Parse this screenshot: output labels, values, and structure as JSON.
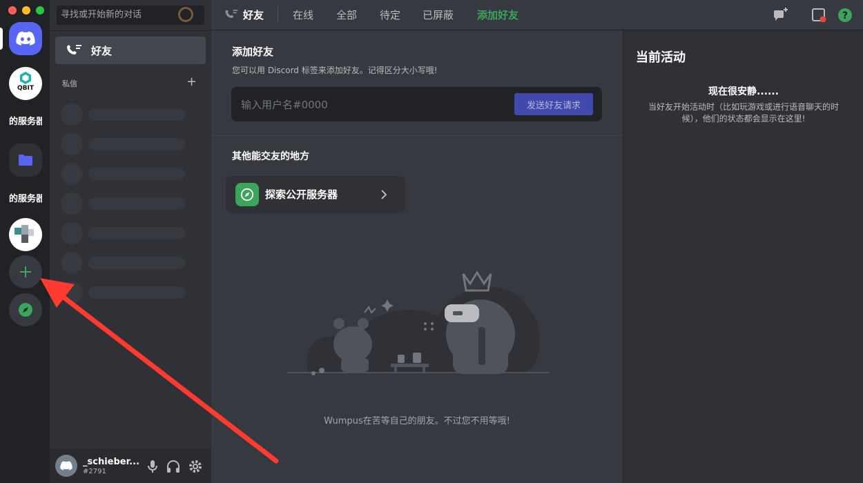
{
  "search": {
    "placeholder": "寻找或开始新的对话"
  },
  "rail": {
    "qbit_label": "QBIT",
    "server_text_1": "的服务器",
    "server_text_2": "的服务器"
  },
  "sidebar": {
    "friends_label": "好友",
    "dm_header": "私信",
    "dm_add": "+"
  },
  "user": {
    "name": "_schieber...",
    "tag": "#2791"
  },
  "topbar": {
    "title": "好友",
    "tabs": [
      "在线",
      "全部",
      "待定",
      "已屏蔽"
    ],
    "add_friend_tab": "添加好友"
  },
  "add_friend": {
    "title": "添加好友",
    "description": "您可以用 Discord 标签来添加好友。记得区分大小写哦!",
    "input_placeholder": "输入用户名#0000",
    "send_button": "发送好友请求"
  },
  "other_places": {
    "title": "其他能交友的地方",
    "explore_label": "探索公开服务器"
  },
  "empty_state": {
    "caption": "Wumpus在苦等自己的朋友。不过您不用等哦!"
  },
  "activity": {
    "title": "当前活动",
    "quiet": "现在很安静......",
    "description": "当好友开始活动时（比如玩游戏或进行语音聊天的时候），他们的状态都会显示在这里!"
  },
  "colors": {
    "accent": "#5865f2",
    "green": "#3ba55c",
    "annotation_arrow": "#ff3b30",
    "help_icon": "#3ba55c",
    "inbox_dot": "#ed4245"
  }
}
